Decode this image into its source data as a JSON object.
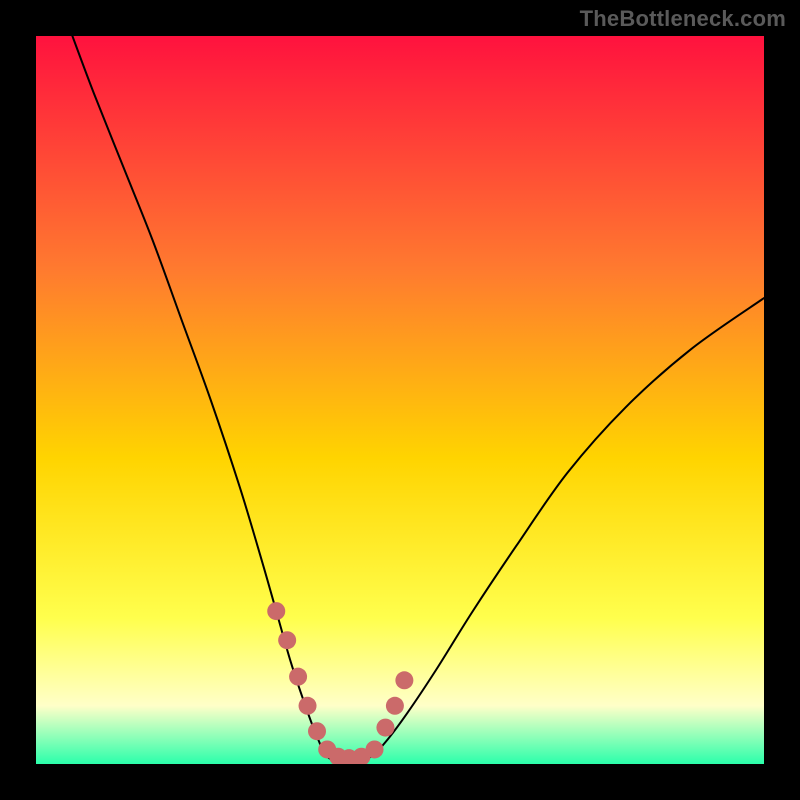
{
  "watermark": "TheBottleneck.com",
  "colors": {
    "background": "#000000",
    "gradient_top": "#ff123e",
    "gradient_mid_upper": "#ff7a2f",
    "gradient_mid": "#ffd400",
    "gradient_lower": "#ffff4d",
    "gradient_pale": "#ffffc8",
    "gradient_bottom": "#2bffab",
    "curve": "#000000",
    "marker": "#cb6a6a"
  },
  "chart_data": {
    "type": "line",
    "title": "",
    "xlabel": "",
    "ylabel": "",
    "xlim": [
      0,
      100
    ],
    "ylim": [
      0,
      100
    ],
    "series": [
      {
        "name": "bottleneck-curve",
        "x": [
          5,
          8,
          12,
          16,
          20,
          24,
          28,
          31,
          33,
          35,
          37,
          38.5,
          40,
          42,
          44,
          46,
          48,
          51,
          55,
          60,
          66,
          73,
          81,
          90,
          100
        ],
        "y": [
          100,
          92,
          82,
          72,
          61,
          50,
          38,
          28,
          21,
          14,
          8,
          4,
          1,
          0.5,
          0.5,
          1,
          3,
          7,
          13,
          21,
          30,
          40,
          49,
          57,
          64
        ]
      }
    ],
    "markers": {
      "name": "highlight-dots",
      "x": [
        33,
        34.5,
        36,
        37.3,
        38.6,
        40,
        41.5,
        43,
        44.7,
        46.5,
        48,
        49.3,
        50.6
      ],
      "y": [
        21,
        17,
        12,
        8,
        4.5,
        2,
        1,
        0.8,
        1,
        2,
        5,
        8,
        11.5
      ],
      "r": 9
    }
  }
}
